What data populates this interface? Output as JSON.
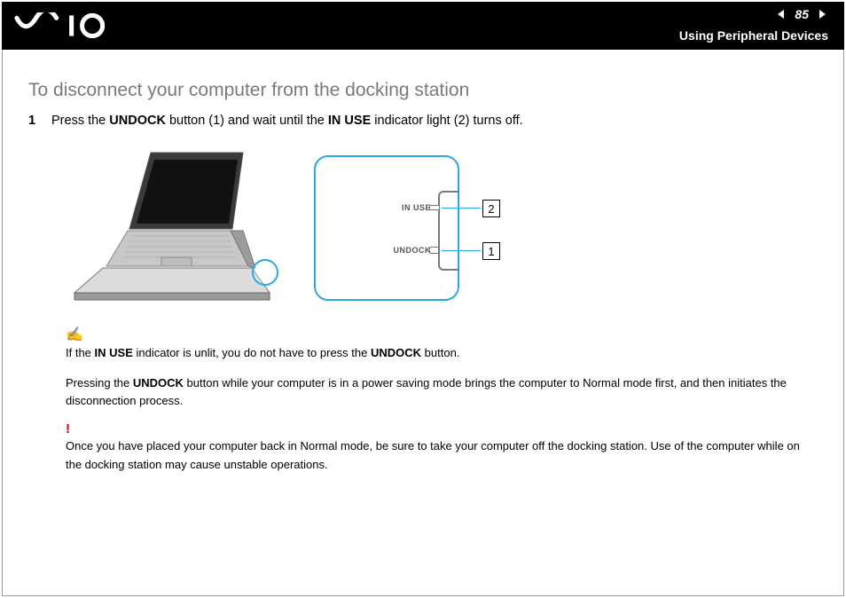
{
  "header": {
    "brand": "VAIO",
    "page_number": "85",
    "section_title": "Using Peripheral Devices"
  },
  "heading": "To disconnect your computer from the docking station",
  "steps": [
    {
      "num": "1",
      "text_parts": [
        "Press the ",
        " button (1) and wait until the ",
        " indicator light (2) turns off."
      ],
      "bold": [
        "UNDOCK",
        "IN USE"
      ]
    }
  ],
  "figure": {
    "label_in_use": "IN USE",
    "label_undock": "UNDOCK",
    "tag1": "1",
    "tag2": "2"
  },
  "notes": {
    "note1_parts": [
      "If the ",
      " indicator is unlit, you do not have to press the ",
      " button."
    ],
    "note1_bold": [
      "IN USE",
      "UNDOCK"
    ],
    "note2_parts": [
      "Pressing the ",
      " button while your computer is in a power saving mode brings the computer to Normal mode first, and then initiates the disconnection process."
    ],
    "note2_bold": [
      "UNDOCK"
    ],
    "warn": "Once you have placed your computer back in Normal mode, be sure to take your computer off the docking station. Use of the computer while on the docking station may cause unstable operations."
  }
}
